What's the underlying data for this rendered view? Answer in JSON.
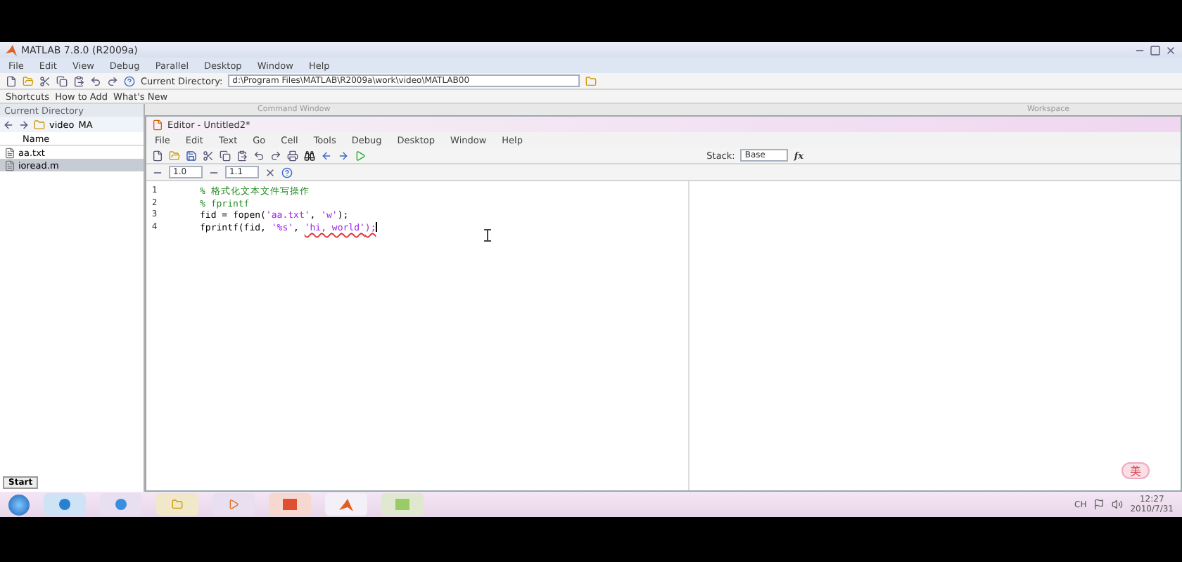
{
  "main_window": {
    "title": "MATLAB  7.8.0 (R2009a)",
    "menu": [
      "File",
      "Edit",
      "View",
      "Debug",
      "Parallel",
      "Desktop",
      "Window",
      "Help"
    ],
    "current_directory_label": "Current Directory:",
    "current_directory": "d:\\Program Files\\MATLAB\\R2009a\\work\\video\\MATLAB00",
    "shortcuts": [
      "Shortcuts",
      "How to Add",
      "What's New"
    ]
  },
  "current_directory_panel": {
    "title": "Current Directory",
    "path": [
      "video",
      "MA"
    ],
    "column": "Name",
    "files": [
      {
        "name": "aa.txt",
        "selected": false
      },
      {
        "name": "ioread.m",
        "selected": true
      }
    ],
    "start_button": "Start"
  },
  "background_panels": [
    "Command Window",
    "Workspace"
  ],
  "editor": {
    "title": "Editor - Untitled2*",
    "menu": [
      "File",
      "Edit",
      "Text",
      "Go",
      "Cell",
      "Tools",
      "Debug",
      "Desktop",
      "Window",
      "Help"
    ],
    "stack_label": "Stack:",
    "stack_value": "Base",
    "cell_toolbar": [
      "1.0",
      "1.1"
    ],
    "function_button": "fx",
    "lines": [
      {
        "number": "1",
        "tokens": [
          {
            "kind": "comment",
            "text": "% 格式化文本文件写操作"
          }
        ]
      },
      {
        "number": "2",
        "tokens": [
          {
            "kind": "comment",
            "text": "% fprintf"
          }
        ]
      },
      {
        "number": "3",
        "tokens": [
          {
            "kind": "code",
            "text": "fid = fopen("
          },
          {
            "kind": "string",
            "text": "'aa.txt'"
          },
          {
            "kind": "code",
            "text": ", "
          },
          {
            "kind": "string",
            "text": "'w'"
          },
          {
            "kind": "code",
            "text": ");"
          }
        ]
      },
      {
        "number": "4",
        "tokens": [
          {
            "kind": "code",
            "text": "fprintf(fid, "
          },
          {
            "kind": "string",
            "text": "'%s'"
          },
          {
            "kind": "code",
            "text": ", "
          },
          {
            "kind": "warning",
            "text": "'hi, world'"
          },
          {
            "kind": "warning",
            "text": ");"
          }
        ]
      }
    ]
  },
  "ime_toolbar": {
    "label": "美"
  },
  "taskbar": {
    "language": "CH",
    "time": "12:27",
    "date": "2010/7/31"
  }
}
